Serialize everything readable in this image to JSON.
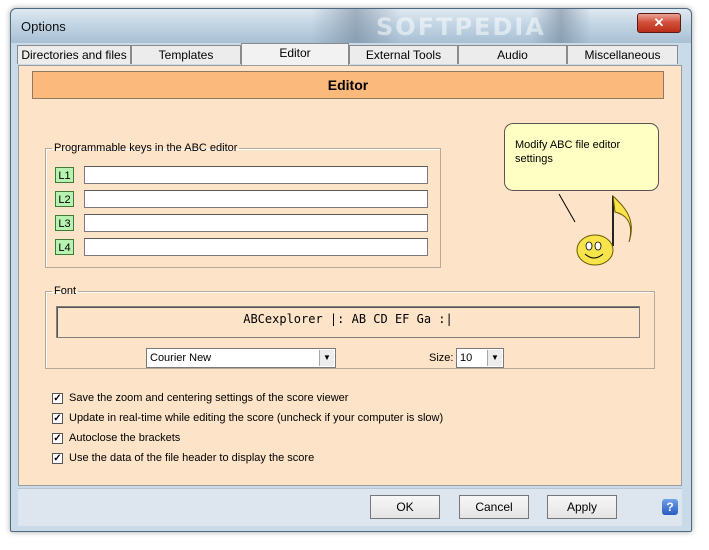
{
  "window": {
    "title": "Options",
    "watermark": "SOFTPEDIA",
    "close_glyph": "✕"
  },
  "tabs": [
    {
      "label": "Directories and files"
    },
    {
      "label": "Templates"
    },
    {
      "label": "Editor"
    },
    {
      "label": "External Tools"
    },
    {
      "label": "Audio"
    },
    {
      "label": "Miscellaneous"
    }
  ],
  "active_tab": "Editor",
  "header": {
    "title": "Editor"
  },
  "keys_group": {
    "legend": "Programmable keys in the ABC editor",
    "keys": [
      {
        "label": "L1",
        "value": ""
      },
      {
        "label": "L2",
        "value": ""
      },
      {
        "label": "L3",
        "value": ""
      },
      {
        "label": "L4",
        "value": ""
      }
    ]
  },
  "tooltip": {
    "text": "Modify ABC file editor settings"
  },
  "font_group": {
    "legend": "Font",
    "preview": "ABCexplorer |: AB CD EF Ga :|",
    "font_name": "Courier New",
    "size_label": "Size:",
    "size_value": "10"
  },
  "options": [
    {
      "label": "Save the zoom and centering settings of the score viewer",
      "checked": true
    },
    {
      "label": "Update in real-time while editing the score (uncheck if your computer is slow)",
      "checked": true
    },
    {
      "label": "Autoclose the brackets",
      "checked": true
    },
    {
      "label": "Use the data of the file header to display the score",
      "checked": true
    }
  ],
  "buttons": {
    "ok": "OK",
    "cancel": "Cancel",
    "apply": "Apply",
    "help": "?"
  },
  "colors": {
    "content_bg": "#fde3c8",
    "header_bg": "#fbb97c",
    "key_label_bg": "#b8f2b0",
    "tooltip_bg": "#ffffc4",
    "note_color": "#f7e34a"
  }
}
